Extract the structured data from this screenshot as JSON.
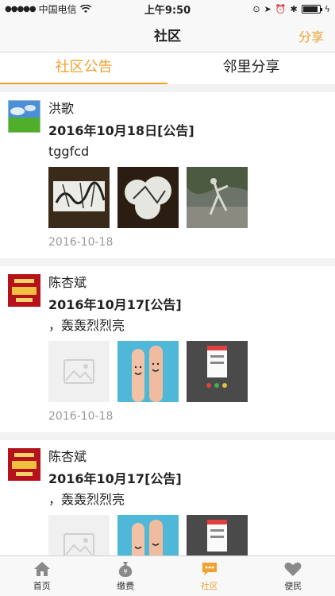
{
  "status": {
    "carrier": "中国电信",
    "time": "上午9:50",
    "battery_level": 0.9
  },
  "nav": {
    "title": "社区",
    "share_label": "分享"
  },
  "tabs": [
    {
      "label": "社区公告",
      "active": true
    },
    {
      "label": "邻里分享",
      "active": false
    }
  ],
  "posts": [
    {
      "author": "洪歌",
      "title": "2016年10月18日[公告]",
      "content": "tggfcd",
      "date": "2016-10-18"
    },
    {
      "author": "陈杏斌",
      "title": "2016年10月17[公告]",
      "content": "，轰轰烈烈亮",
      "date": "2016-10-18"
    },
    {
      "author": "陈杏斌",
      "title": "2016年10月17[公告]",
      "content": "，轰轰烈烈亮",
      "date": ""
    }
  ],
  "tabbar": [
    {
      "label": "首页",
      "icon": "home-icon"
    },
    {
      "label": "缴费",
      "icon": "money-bag-icon"
    },
    {
      "label": "社区",
      "icon": "chat-icon",
      "active": true
    },
    {
      "label": "便民",
      "icon": "heart-icon"
    }
  ],
  "colors": {
    "accent": "#f0a030"
  }
}
